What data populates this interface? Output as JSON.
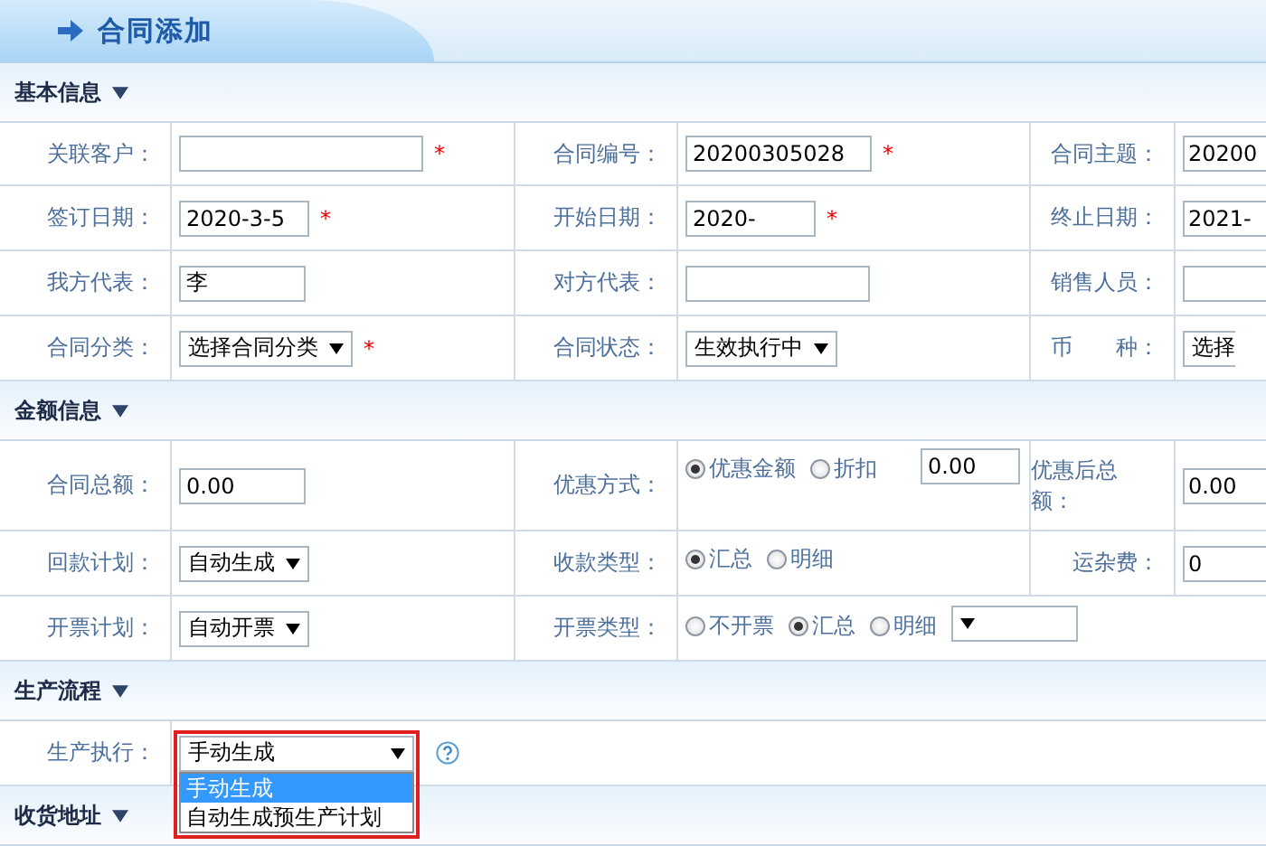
{
  "header": {
    "title": "合同添加"
  },
  "sections": [
    {
      "title": "基本信息",
      "expanded": true,
      "rows": [
        {
          "cells": [
            {
              "label": "关联客户：",
              "field": {
                "kind": "text",
                "mark": "*"
              }
            },
            {
              "label": "合同编号：",
              "field": {
                "kind": "text",
                "value": "20200305028",
                "mark": "*"
              }
            },
            {
              "label": "合同主题：",
              "field": {
                "kind": "text",
                "value": "20200"
              }
            }
          ]
        },
        {
          "cells": [
            {
              "label": "签订日期：",
              "field": {
                "kind": "text",
                "value": "2020-3-5",
                "mark": "*"
              }
            },
            {
              "label": "开始日期：",
              "field": {
                "kind": "text",
                "value": "2020-",
                "mark": "*"
              }
            },
            {
              "label": "终止日期：",
              "field": {
                "kind": "text",
                "value": "2021-"
              }
            }
          ]
        },
        {
          "cells": [
            {
              "label": "我方代表：",
              "field": {
                "kind": "text",
                "value": "李"
              }
            },
            {
              "label": "对方代表：",
              "field": {
                "kind": "text"
              }
            },
            {
              "label": "销售人员：",
              "field": {
                "kind": "text"
              }
            }
          ]
        },
        {
          "cells": [
            {
              "label": "合同分类：",
              "field": {
                "kind": "select",
                "value": "选择合同分类",
                "mark": "*"
              }
            },
            {
              "label": "合同状态：",
              "field": {
                "kind": "select",
                "value": "生效执行中"
              }
            },
            {
              "label": "币　　种：",
              "field": {
                "kind": "select",
                "value": "选择"
              }
            }
          ]
        }
      ]
    },
    {
      "title": "金额信息",
      "expanded": true,
      "rows": [
        {
          "cells": [
            {
              "label": "合同总额：",
              "field": {
                "kind": "text",
                "value": "0.00"
              }
            },
            {
              "label": "优惠方式：",
              "field": {
                "kind": "radios",
                "options": [
                  {
                    "label": "优惠金额",
                    "selected": true
                  },
                  {
                    "label": "折扣",
                    "selected": false
                  }
                ],
                "extra": {
                  "kind": "text",
                  "value": "0.00"
                }
              }
            },
            {
              "label": "优惠后总额：",
              "field": {
                "kind": "text",
                "value": "0.00"
              }
            }
          ]
        },
        {
          "cells": [
            {
              "label": "回款计划：",
              "field": {
                "kind": "select",
                "value": "自动生成"
              }
            },
            {
              "label": "收款类型：",
              "field": {
                "kind": "radios",
                "options": [
                  {
                    "label": "汇总",
                    "selected": true
                  },
                  {
                    "label": "明细",
                    "selected": false
                  }
                ]
              }
            },
            {
              "label": "运杂费：",
              "field": {
                "kind": "text",
                "value": "0"
              }
            }
          ]
        },
        {
          "cells": [
            {
              "label": "开票计划：",
              "field": {
                "kind": "select",
                "value": "自动开票"
              }
            },
            {
              "label": "开票类型：",
              "field": {
                "kind": "radios",
                "options": [
                  {
                    "label": "不开票",
                    "selected": false
                  },
                  {
                    "label": "汇总",
                    "selected": true
                  },
                  {
                    "label": "明细",
                    "selected": false
                  }
                ],
                "extra": {
                  "kind": "select"
                }
              }
            }
          ]
        }
      ]
    },
    {
      "title": "生产流程",
      "expanded": true,
      "rows": [
        {
          "cells": [
            {
              "label": "生产执行：",
              "field": {
                "kind": "select",
                "value": "手动生成",
                "open": true,
                "highlighted": true,
                "help": true,
                "options": [
                  {
                    "label": "手动生成",
                    "selected": true
                  },
                  {
                    "label": "自动生成预生产计划",
                    "selected": false
                  }
                ]
              }
            }
          ]
        }
      ]
    },
    {
      "title": "收货地址",
      "expanded": true
    }
  ]
}
